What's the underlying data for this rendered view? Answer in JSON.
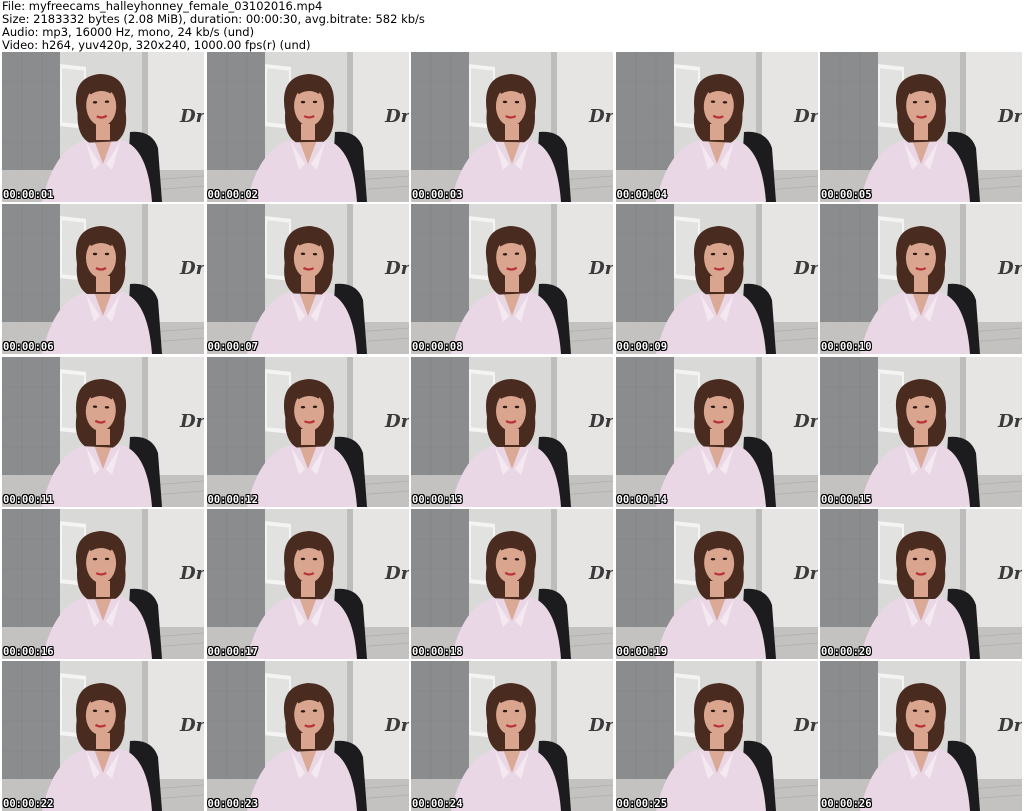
{
  "header": {
    "file_line": "File: myfreecams_halleyhonney_female_03102016.mp4",
    "size_line": "Size: 2183332 bytes (2.08 MiB), duration: 00:00:30, avg.bitrate: 582 kb/s",
    "audio_line": "Audio: mp3, 16000 Hz, mono, 24 kb/s (und)",
    "video_line": "Video: h264, yuv420p, 320x240, 1000.00 fps(r) (und)"
  },
  "frames": [
    {
      "timestamp": "00:00:01"
    },
    {
      "timestamp": "00:00:02"
    },
    {
      "timestamp": "00:00:03"
    },
    {
      "timestamp": "00:00:04"
    },
    {
      "timestamp": "00:00:05"
    },
    {
      "timestamp": "00:00:06"
    },
    {
      "timestamp": "00:00:07"
    },
    {
      "timestamp": "00:00:08"
    },
    {
      "timestamp": "00:00:09"
    },
    {
      "timestamp": "00:00:10"
    },
    {
      "timestamp": "00:00:11"
    },
    {
      "timestamp": "00:00:12"
    },
    {
      "timestamp": "00:00:13"
    },
    {
      "timestamp": "00:00:14"
    },
    {
      "timestamp": "00:00:15"
    },
    {
      "timestamp": "00:00:16"
    },
    {
      "timestamp": "00:00:17"
    },
    {
      "timestamp": "00:00:18"
    },
    {
      "timestamp": "00:00:19"
    },
    {
      "timestamp": "00:00:20"
    },
    {
      "timestamp": "00:00:22"
    },
    {
      "timestamp": "00:00:23"
    },
    {
      "timestamp": "00:00:24"
    },
    {
      "timestamp": "00:00:25"
    },
    {
      "timestamp": "00:00:26"
    }
  ],
  "colors": {
    "wall_gray": "#8a8c8e",
    "wall_light": "#d9d9d8",
    "floor": "#c4c2c0",
    "shirt": "#ead7e6",
    "hair": "#4a2b20",
    "skin": "#d9a58e",
    "chair": "#1c1c1e",
    "lips": "#b8323a"
  }
}
